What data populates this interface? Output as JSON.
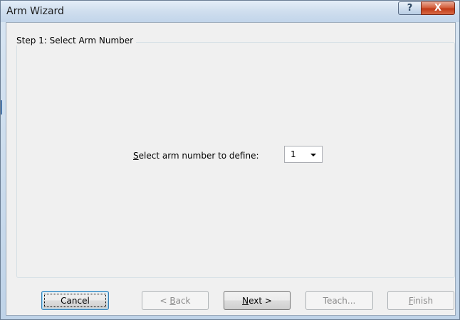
{
  "window": {
    "title": "Arm Wizard",
    "help_label": "?",
    "close_label": "X"
  },
  "group": {
    "label": "Step 1: Select Arm Number"
  },
  "prompt": {
    "mnemonic": "S",
    "rest": "elect arm number to define:"
  },
  "combo": {
    "value": "1"
  },
  "buttons": {
    "cancel": "Cancel",
    "back_prefix": "< ",
    "back_mnemonic": "B",
    "back_rest": "ack",
    "next_mnemonic": "N",
    "next_rest": "ext >",
    "teach": "Teach...",
    "finish_mnemonic": "F",
    "finish_rest": "inish"
  },
  "colors": {
    "close_button": "#c03a18",
    "dialog_bg": "#f0f0f0",
    "default_button_border": "#3c7fb1"
  }
}
